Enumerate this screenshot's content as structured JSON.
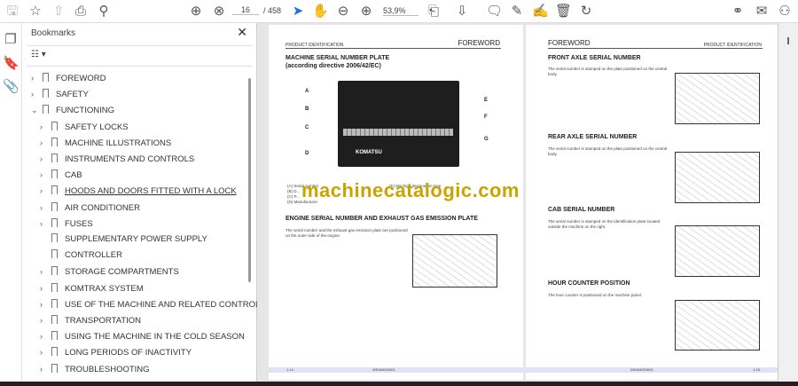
{
  "toolbar": {
    "page_current": "16",
    "page_total": "/ 458",
    "zoom": "53,9%",
    "icons": [
      "save-icon",
      "star-icon",
      "upload-icon",
      "print-icon",
      "search-icon",
      "page-up-icon",
      "page-down-icon",
      "cursor-icon",
      "hand-icon",
      "zoom-out-icon",
      "zoom-in-icon",
      "fit-page-icon",
      "scroll-mode-icon",
      "comment-icon",
      "pen-icon",
      "sign-icon",
      "delete-icon",
      "rotate-icon",
      "share-icon",
      "mail-icon",
      "account-icon"
    ]
  },
  "bookmarks": {
    "title": "Bookmarks",
    "items": [
      {
        "label": "FOREWORD",
        "level": 0,
        "state": "collapsed"
      },
      {
        "label": "SAFETY",
        "level": 0,
        "state": "collapsed"
      },
      {
        "label": "FUNCTIONING",
        "level": 0,
        "state": "expanded"
      },
      {
        "label": "SAFETY LOCKS",
        "level": 1,
        "state": "collapsed"
      },
      {
        "label": "MACHINE ILLUSTRATIONS",
        "level": 1,
        "state": "collapsed"
      },
      {
        "label": "INSTRUMENTS AND CONTROLS",
        "level": 1,
        "state": "collapsed"
      },
      {
        "label": "CAB",
        "level": 1,
        "state": "collapsed"
      },
      {
        "label": "HOODS AND DOORS FITTED WITH A LOCK",
        "level": 1,
        "state": "collapsed",
        "underline": true
      },
      {
        "label": "AIR CONDITIONER",
        "level": 1,
        "state": "collapsed"
      },
      {
        "label": "FUSES",
        "level": 1,
        "state": "collapsed"
      },
      {
        "label": "SUPPLEMENTARY POWER SUPPLY",
        "level": 1,
        "state": "leaf"
      },
      {
        "label": "CONTROLLER",
        "level": 1,
        "state": "leaf"
      },
      {
        "label": "STORAGE COMPARTMENTS",
        "level": 1,
        "state": "collapsed"
      },
      {
        "label": "KOMTRAX SYSTEM",
        "level": 1,
        "state": "collapsed"
      },
      {
        "label": "USE OF THE MACHINE AND RELATED CONTROLS",
        "level": 1,
        "state": "collapsed"
      },
      {
        "label": "TRANSPORTATION",
        "level": 1,
        "state": "collapsed"
      },
      {
        "label": "USING THE MACHINE IN THE COLD SEASON",
        "level": 1,
        "state": "collapsed"
      },
      {
        "label": "LONG PERIODS OF INACTIVITY",
        "level": 1,
        "state": "collapsed"
      },
      {
        "label": "TROUBLESHOOTING",
        "level": 1,
        "state": "collapsed"
      }
    ]
  },
  "left_page": {
    "header_left": "PRODUCT IDENTIFICATION",
    "header_right": "FOREWORD",
    "title1": "MACHINE SERIAL NUMBER PLATE",
    "title2": "(according directive 2006/42/EC)",
    "plate_brand": "KOMATSU",
    "labels": [
      "A",
      "B",
      "C",
      "D",
      "E",
      "F",
      "G"
    ],
    "legend": [
      "(A)  Serial number",
      "(B)  D...",
      "(C)  P...",
      "(D)  Manufacturer",
      "(E)  Machine designation type"
    ],
    "title3": "ENGINE SERIAL NUMBER AND EXHAUST GAS EMISSION PLATE",
    "text3": "The serial number and the exhaust gas emission plate are positioned on the outer side of the engine.",
    "footer_left": "1-14",
    "footer_mid": "WEAM015001"
  },
  "right_page": {
    "header_left": "FOREWORD",
    "header_right": "PRODUCT IDENTIFICATION",
    "sections": [
      {
        "title": "FRONT AXLE SERIAL NUMBER",
        "text": "The serial number is stamped on the plate positioned on the central body."
      },
      {
        "title": "REAR AXLE SERIAL NUMBER",
        "text": "The serial number is stamped on the plate positioned on the central body."
      },
      {
        "title": "CAB SERIAL NUMBER",
        "text": "The serial number is stamped on the identification plate located outside the machine on the right."
      },
      {
        "title": "HOUR COUNTER POSITION",
        "text": "The hour counter is positioned on the machine panel."
      }
    ],
    "footer_mid": "WEAM015001",
    "footer_right": "1-15"
  },
  "watermark": "machinecatalogic.com"
}
